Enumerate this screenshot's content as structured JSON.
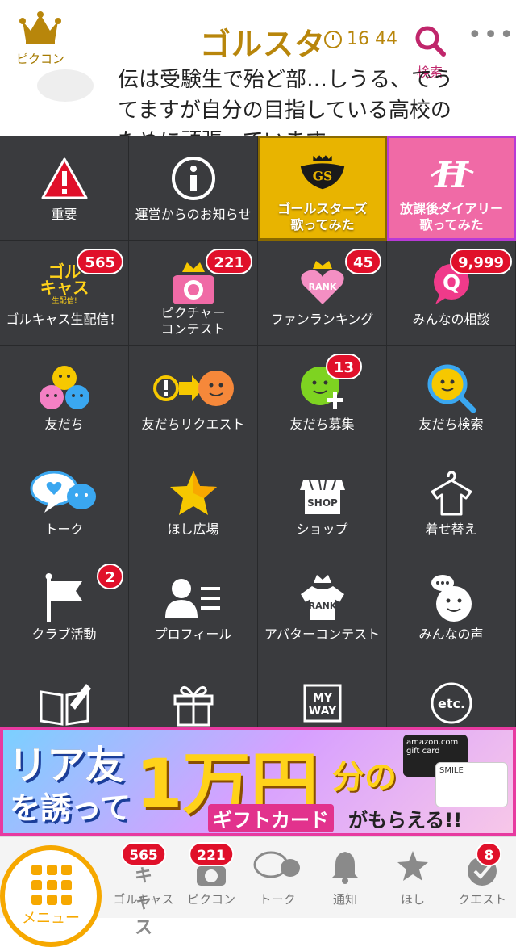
{
  "header": {
    "left_label": "ピクコン",
    "logo": "ゴルスタ",
    "time": "16 44",
    "search_label": "検索"
  },
  "background_post": {
    "lines": [
      "伝は受験生で殆ど部…しうる、でう",
      "てますが自分の目指している高校の",
      "ために頑張っています"
    ]
  },
  "menu": {
    "items": [
      {
        "label": "重要",
        "icon": "warning-icon"
      },
      {
        "label": "運営からのお知らせ",
        "icon": "info-icon"
      },
      {
        "label": "ゴールスターズ\n歌ってみた",
        "icon": "golstars-emblem-icon",
        "style": "gold"
      },
      {
        "label": "放課後ダイアリー\n歌ってみた",
        "icon": "houkago-diary-logo-icon",
        "style": "pink"
      },
      {
        "label": "ゴルキャス生配信！",
        "icon": "golcas-live-icon",
        "badge": "565"
      },
      {
        "label": "ピクチャー\nコンテスト",
        "icon": "camera-crown-icon",
        "badge": "221"
      },
      {
        "label": "ファンランキング",
        "icon": "rank-heart-icon",
        "badge": "45"
      },
      {
        "label": "みんなの相談",
        "icon": "q-bubble-icon",
        "badge": "9,999"
      },
      {
        "label": "友だち",
        "icon": "friends-faces-icon"
      },
      {
        "label": "友だちリクエスト",
        "icon": "friend-request-icon"
      },
      {
        "label": "友だち募集",
        "icon": "friend-recruit-icon",
        "badge": "13"
      },
      {
        "label": "友だち検索",
        "icon": "friend-search-icon"
      },
      {
        "label": "トーク",
        "icon": "talk-bubbles-icon"
      },
      {
        "label": "ほし広場",
        "icon": "star-plaza-icon"
      },
      {
        "label": "ショップ",
        "icon": "shop-icon",
        "icon_text": "SHOP"
      },
      {
        "label": "着せ替え",
        "icon": "hanger-shirt-icon"
      },
      {
        "label": "クラブ活動",
        "icon": "flag-icon",
        "badge": "2"
      },
      {
        "label": "プロフィール",
        "icon": "profile-icon"
      },
      {
        "label": "アバターコンテスト",
        "icon": "rank-shirt-icon",
        "icon_text": "RANK"
      },
      {
        "label": "みんなの声",
        "icon": "voice-face-icon"
      },
      {
        "label": "",
        "icon": "book-pen-icon"
      },
      {
        "label": "",
        "icon": "gift-icon"
      },
      {
        "label": "",
        "icon": "my-way-icon",
        "icon_text": "MY\nWAY"
      },
      {
        "label": "",
        "icon": "etc-icon",
        "icon_text": "etc."
      }
    ],
    "rank_text": "RANK"
  },
  "banner": {
    "line1": "リア友",
    "line2": "を誘って",
    "big": "1万円",
    "suffix": "分の",
    "sub1": "ギフトカード",
    "sub2": "がもらえる!!",
    "card1": "amazon.com gift card",
    "card2": "SMILE"
  },
  "tabbar": {
    "menu_label": "メニュー",
    "tabs": [
      {
        "label": "ゴルキャス",
        "badge": "565",
        "icon": "golcas-tab-icon"
      },
      {
        "label": "ピクコン",
        "badge": "221",
        "icon": "camera-tab-icon"
      },
      {
        "label": "トーク",
        "badge": "",
        "icon": "talk-tab-icon"
      },
      {
        "label": "通知",
        "badge": "",
        "icon": "bell-icon"
      },
      {
        "label": "ほし",
        "badge": "",
        "icon": "star-tab-icon"
      },
      {
        "label": "クエスト",
        "badge": "8",
        "icon": "check-circle-icon"
      }
    ]
  },
  "colors": {
    "gold": "#b8860b",
    "accent": "#f6a800",
    "badge": "#e0102a",
    "menu_bg": "#3a3b3e",
    "search": "#c0266b"
  }
}
